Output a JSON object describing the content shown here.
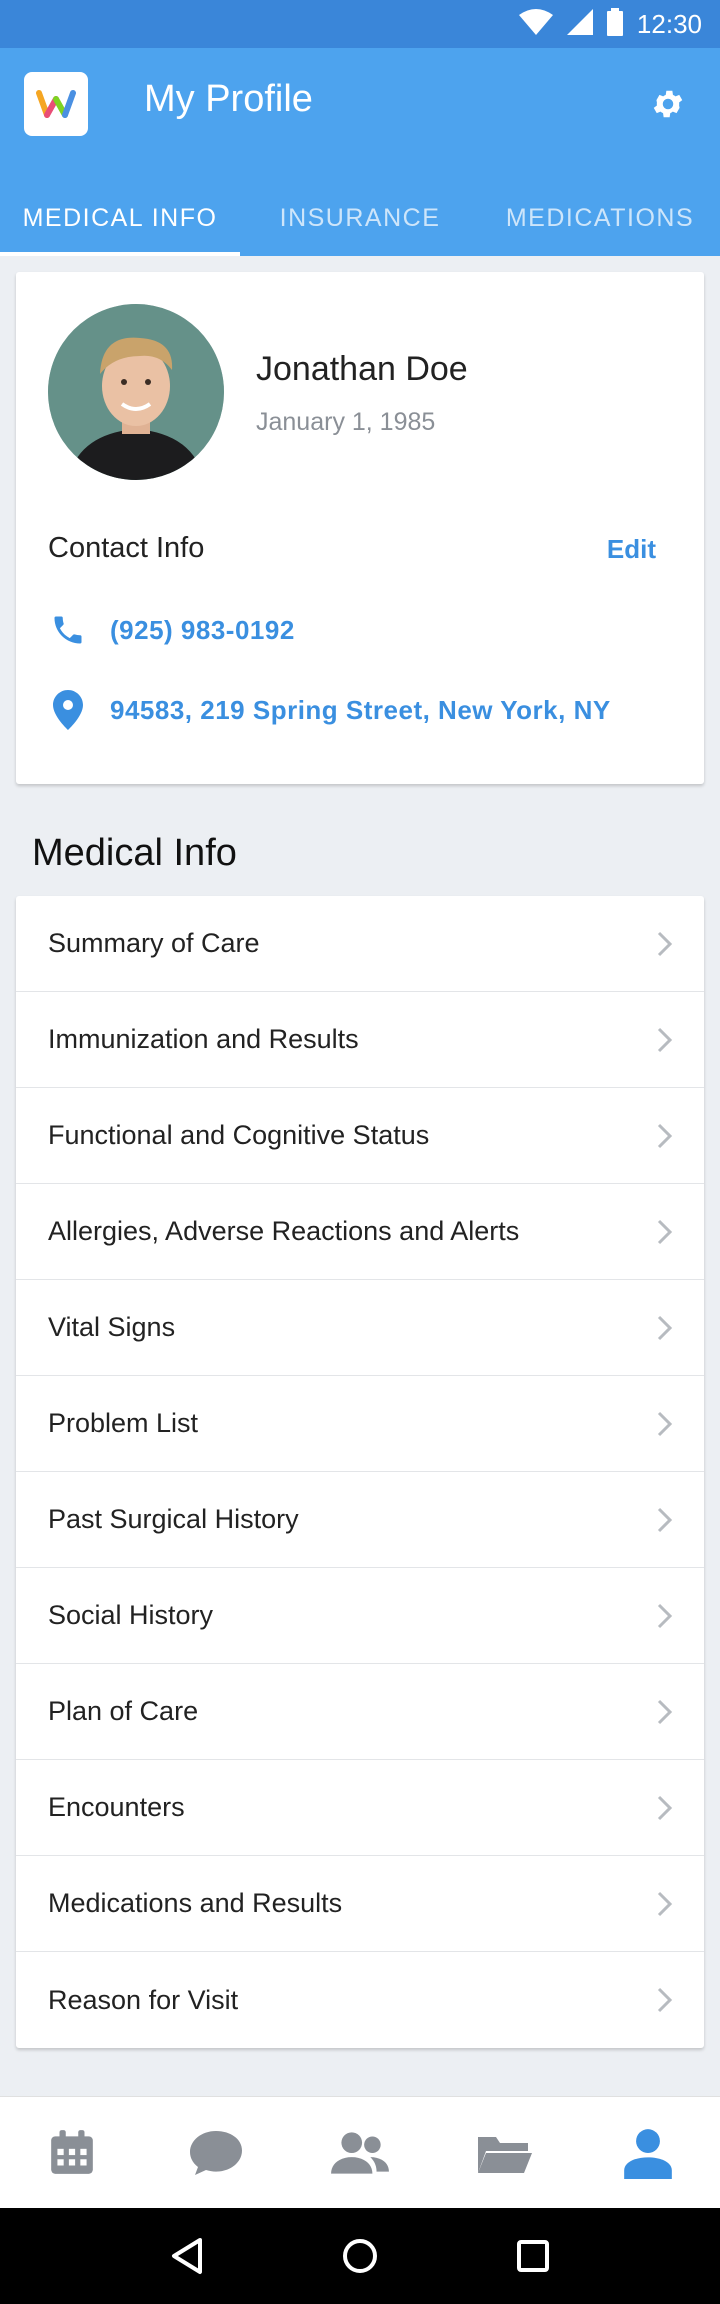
{
  "status_bar": {
    "time": "12:30"
  },
  "app_bar": {
    "title": "My Profile"
  },
  "tabs": [
    {
      "label": "MEDICAL INFO",
      "active": true
    },
    {
      "label": "INSURANCE",
      "active": false
    },
    {
      "label": "MEDICATIONS",
      "active": false
    }
  ],
  "profile": {
    "name": "Jonathan Doe",
    "dob": "January 1, 1985",
    "contact_heading": "Contact Info",
    "edit_label": "Edit",
    "phone": "(925) 983-0192",
    "address": "94583, 219 Spring Street, New York, NY"
  },
  "medical_info": {
    "heading": "Medical Info",
    "items": [
      "Summary of Care",
      "Immunization and Results",
      "Functional and Cognitive Status",
      "Allergies, Adverse Reactions and Alerts",
      "Vital Signs",
      "Problem List",
      "Past Surgical History",
      "Social History",
      "Plan of Care",
      "Encounters",
      "Medications and Results",
      "Reason for Visit"
    ]
  },
  "bottom_nav": [
    {
      "icon": "calendar-icon",
      "active": false
    },
    {
      "icon": "chat-icon",
      "active": false
    },
    {
      "icon": "people-icon",
      "active": false
    },
    {
      "icon": "folder-icon",
      "active": false
    },
    {
      "icon": "person-icon",
      "active": true
    }
  ],
  "colors": {
    "status_bar": "#3a86d9",
    "app_bar": "#4da3ee",
    "accent": "#3a8fe0",
    "nav_inactive": "#8a8f96"
  }
}
